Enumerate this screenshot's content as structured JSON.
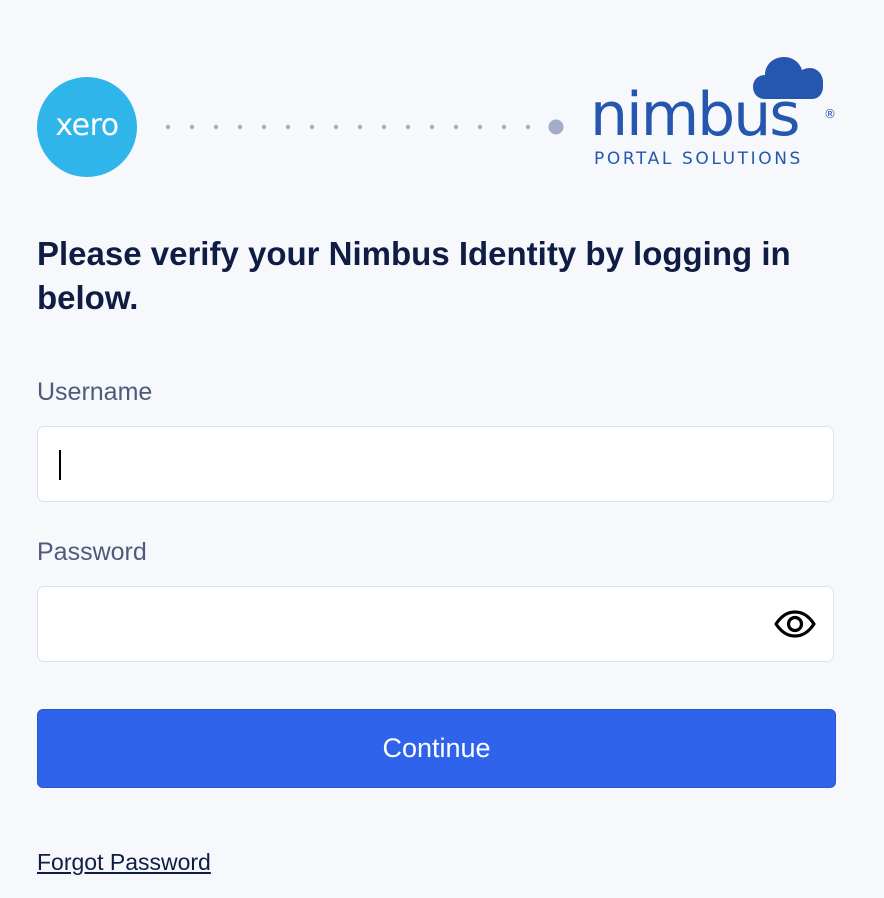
{
  "header": {
    "xero_logo_text": "xero",
    "nimbus_logo": {
      "name": "nimbus",
      "registered_mark": "®",
      "tagline": "PORTAL SOLUTIONS"
    }
  },
  "heading": "Please verify your Nimbus Identity by logging in below.",
  "form": {
    "username": {
      "label": "Username",
      "value": "",
      "placeholder": ""
    },
    "password": {
      "label": "Password",
      "value": "",
      "placeholder": "",
      "toggle_icon": "eye-icon"
    },
    "continue_label": "Continue",
    "forgot_password_label": "Forgot Password"
  },
  "colors": {
    "background": "#f6f8fb",
    "xero_brand": "#2fb5e9",
    "nimbus_brand": "#2457ad",
    "primary_button": "#2f63ec",
    "heading_text": "#0f1d45",
    "label_text": "#4f5b78"
  }
}
